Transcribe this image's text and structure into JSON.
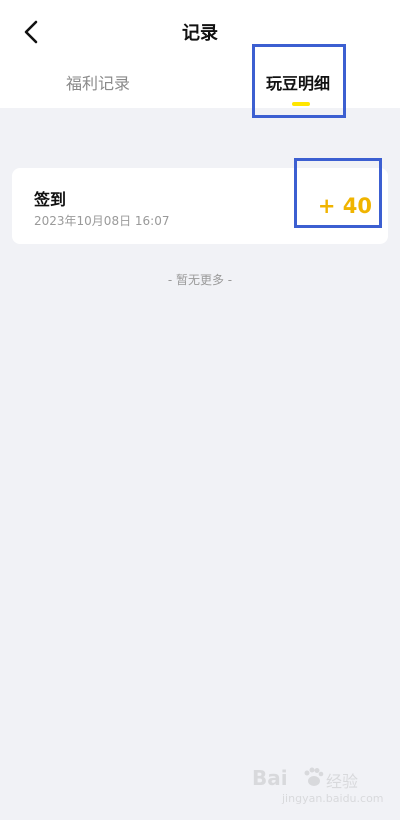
{
  "header": {
    "title": "记录",
    "back_icon": "chevron-left-icon",
    "tabs": [
      {
        "label": "福利记录",
        "active": false
      },
      {
        "label": "玩豆明细",
        "active": true
      }
    ],
    "accent_color": "#ffe600"
  },
  "records": [
    {
      "title": "签到",
      "time": "2023年10月08日 16:07",
      "amount": "+ 40",
      "amount_color": "#f0b400"
    }
  ],
  "list_end_text": "- 暂无更多 -",
  "annotation_color": "#3c5fd1",
  "watermark": {
    "brand": "Bai",
    "brand_suffix": "经验",
    "url": "jingyan.baidu.com"
  }
}
